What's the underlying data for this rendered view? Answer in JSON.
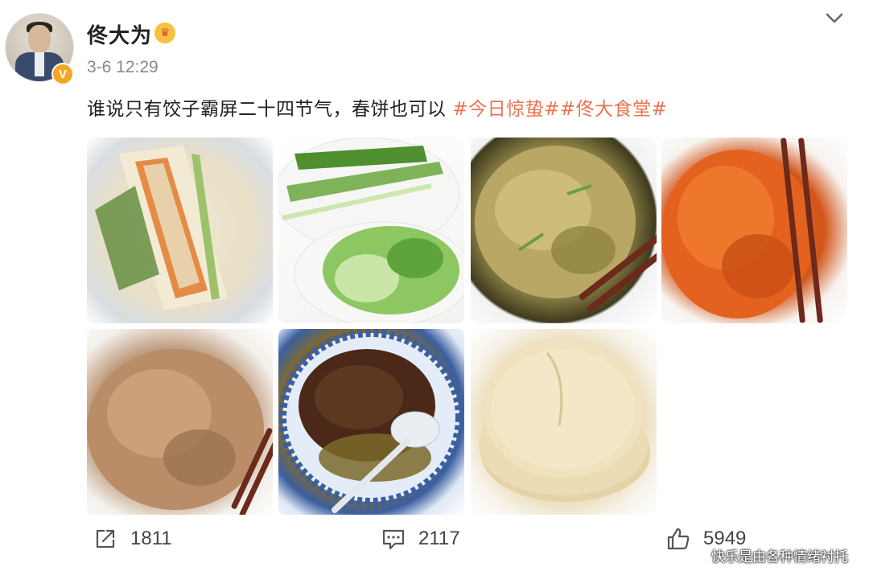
{
  "post": {
    "username": "佟大为",
    "timestamp": "3-6 12:29",
    "text": "谁说只有饺子霸屏二十四节气，春饼也可以",
    "hashtags": [
      "#今日惊蛰#",
      "#佟大食堂#"
    ]
  },
  "photos": [
    {
      "subject": "spring-pancake-wrap"
    },
    {
      "subject": "scallions-and-lettuce"
    },
    {
      "subject": "stir-fried-bean-sprouts"
    },
    {
      "subject": "shredded-carrots"
    },
    {
      "subject": "shredded-pork"
    },
    {
      "subject": "minced-meat-sauce"
    },
    {
      "subject": "stacked-pancakes"
    }
  ],
  "stats": {
    "shares": "1811",
    "comments": "2117",
    "likes": "5949"
  },
  "watermark": "快乐是由各种情绪衬托",
  "icons": {
    "verified": "verified-v-badge-icon",
    "crown": "crown-icon",
    "menu": "chevron-down-icon",
    "share": "share-icon",
    "comment": "comment-icon",
    "like": "thumbs-up-icon"
  },
  "colors": {
    "hashtag": "#eb7350",
    "verified_badge": "#f5a623"
  }
}
